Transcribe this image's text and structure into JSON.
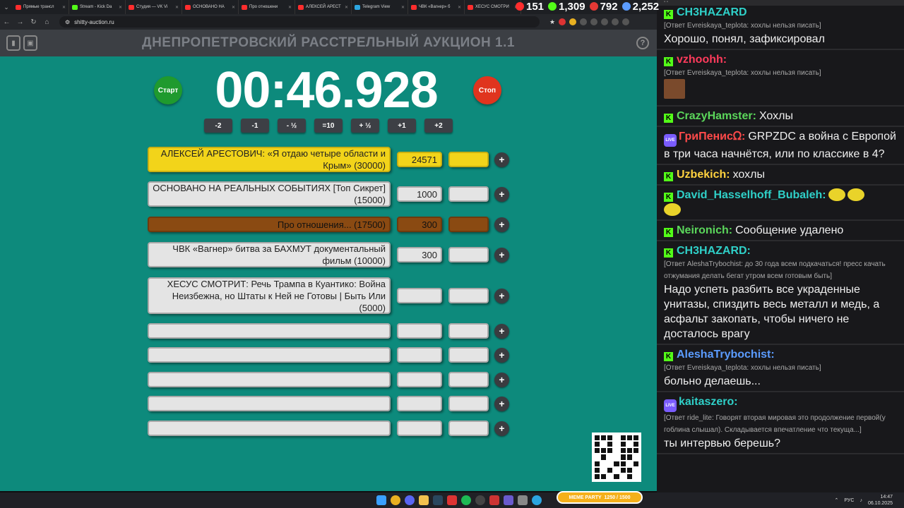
{
  "browser": {
    "tabs": [
      {
        "title": "Прямые трансл",
        "color": "#ff2d2d"
      },
      {
        "title": "Stream - Kick Da",
        "color": "#53fc18"
      },
      {
        "title": "Студия — VK Vi",
        "color": "#ff2d2d"
      },
      {
        "title": "ОСНОВАНО НА",
        "color": "#ff2d2d"
      },
      {
        "title": "Про отношени",
        "color": "#ff2d2d"
      },
      {
        "title": "АЛЕКСЕЙ АРЕСТ",
        "color": "#ff2d2d"
      },
      {
        "title": "Telegram View",
        "color": "#2ca5e0"
      },
      {
        "title": "ЧВК «Вагнер» б",
        "color": "#ff2d2d"
      },
      {
        "title": "ХЕСУС СМОТРИ",
        "color": "#ff2d2d"
      }
    ],
    "url": "shitty-auction.ru",
    "stream_stats": [
      {
        "value": "151",
        "icon": "youtube-icon",
        "color": "#ff2d2d"
      },
      {
        "value": "1,309",
        "icon": "kick-icon",
        "color": "#53fc18"
      },
      {
        "value": "792",
        "icon": "vk-live-icon",
        "color": "#e53935"
      },
      {
        "value": "2,252",
        "icon": "viewers-icon",
        "color": "#5b9cff"
      }
    ]
  },
  "auction": {
    "title": "ДНЕПРОПЕТРОВСКИЙ РАССТРЕЛЬНЫЙ АУКЦИОН 1.1",
    "start_label": "Старт",
    "stop_label": "Стоп",
    "timer": "00:46.928",
    "adjust_buttons": [
      "-2",
      "-1",
      "- ½",
      "=10",
      "+ ½",
      "+1",
      "+2"
    ],
    "lots": [
      {
        "name": "АЛЕКСЕЙ АРЕСТОВИЧ: «Я отдаю четыре области и Крым» (30000)",
        "amount": "24571",
        "style": "yellow"
      },
      {
        "name": "ОСНОВАНО НА РЕАЛЬНЫХ СОБЫТИЯХ [Топ Сикрет] (15000)",
        "amount": "1000",
        "style": "grey"
      },
      {
        "name": "Про отношения... (17500)",
        "amount": "300",
        "style": "brown"
      },
      {
        "name": "ЧВК «Вагнер» битва за БАХМУТ документальный фильм (10000)",
        "amount": "300",
        "style": "grey"
      },
      {
        "name": "ХЕСУС СМОТРИТ: Речь Трампа в Куантико: Война Неизбежна, но Штаты к Ней не Готовы | Быть Или (5000)",
        "amount": "",
        "style": "grey"
      },
      {
        "name": "",
        "amount": "",
        "style": "grey"
      },
      {
        "name": "",
        "amount": "",
        "style": "grey"
      },
      {
        "name": "",
        "amount": "",
        "style": "grey"
      },
      {
        "name": "",
        "amount": "",
        "style": "grey"
      },
      {
        "name": "",
        "amount": "",
        "style": "grey"
      }
    ],
    "add_label": "+"
  },
  "chat": {
    "messages": [
      {
        "platform": "kick",
        "nick": "CH3HAZARD",
        "nick_color": "#2fd0c8",
        "quote": "[Ответ Evreiskaya_teplota: хохлы нельзя писать]",
        "text": "Хорошо, понял, зафиксировал",
        "emote": false
      },
      {
        "platform": "kick",
        "nick": "vzhoohh:",
        "nick_color": "#ff3b5c",
        "quote": "[Ответ Evreiskaya_teplota: хохлы нельзя писать]",
        "text": "",
        "emote": true
      },
      {
        "platform": "kick",
        "nick": "CrazyHamster:",
        "nick_color": "#5bd75b",
        "quote": "",
        "text": "Хохлы",
        "emote": false
      },
      {
        "platform": "vk",
        "nick": "ГриПенисᘯ:",
        "nick_color": "#ff4a4a",
        "quote": "",
        "text": "GRPZDC а война с Европой в три часа начнётся, или по классике в 4?",
        "emote": false
      },
      {
        "platform": "kick",
        "nick": "Uzbekich:",
        "nick_color": "#ffd23f",
        "quote": "",
        "text": "хохлы",
        "emote": false
      },
      {
        "platform": "kick",
        "nick": "David_Hasselhoff_Bubaleh:",
        "nick_color": "#2fd0c8",
        "quote": "",
        "text": "",
        "emote": false
      },
      {
        "platform": "kick",
        "nick": "Neironich:",
        "nick_color": "#5bd75b",
        "quote": "",
        "text": "Сообщение удалено",
        "emote": false
      },
      {
        "platform": "kick",
        "nick": "CH3HAZARD:",
        "nick_color": "#2fd0c8",
        "quote": "[Ответ AleshaTrybochist: до 30 года всем подкачаться! пресс качать отжумания делать бегат утром всем готовым быть]",
        "text": "Надо успеть разбить все украденные унитазы, спиздить весь металл и медь, а асфальт закопать, чтобы ничего не досталось врагу",
        "emote": false
      },
      {
        "platform": "kick",
        "nick": "AleshaTrybochist:",
        "nick_color": "#5b9cff",
        "quote": "[Ответ Evreiskaya_teplota: хохлы нельзя писать]",
        "text": "больно делаешь...",
        "emote": false
      },
      {
        "platform": "vk",
        "nick": "kaitaszero:",
        "nick_color": "#2fd0c8",
        "quote": "[Ответ ride_lite: Говорят вторая мировая это продолжение первой(у гоблина слышал). Складывается впечатление что текуща...]",
        "text": "ты интервью берешь?",
        "emote": false
      }
    ]
  },
  "overlay": {
    "meme_party": "MEME PARTY",
    "meme_progress": "1250 / 1500"
  },
  "taskbar": {
    "lang": "РУС",
    "time": "14:47",
    "date": "06.10.2025"
  }
}
